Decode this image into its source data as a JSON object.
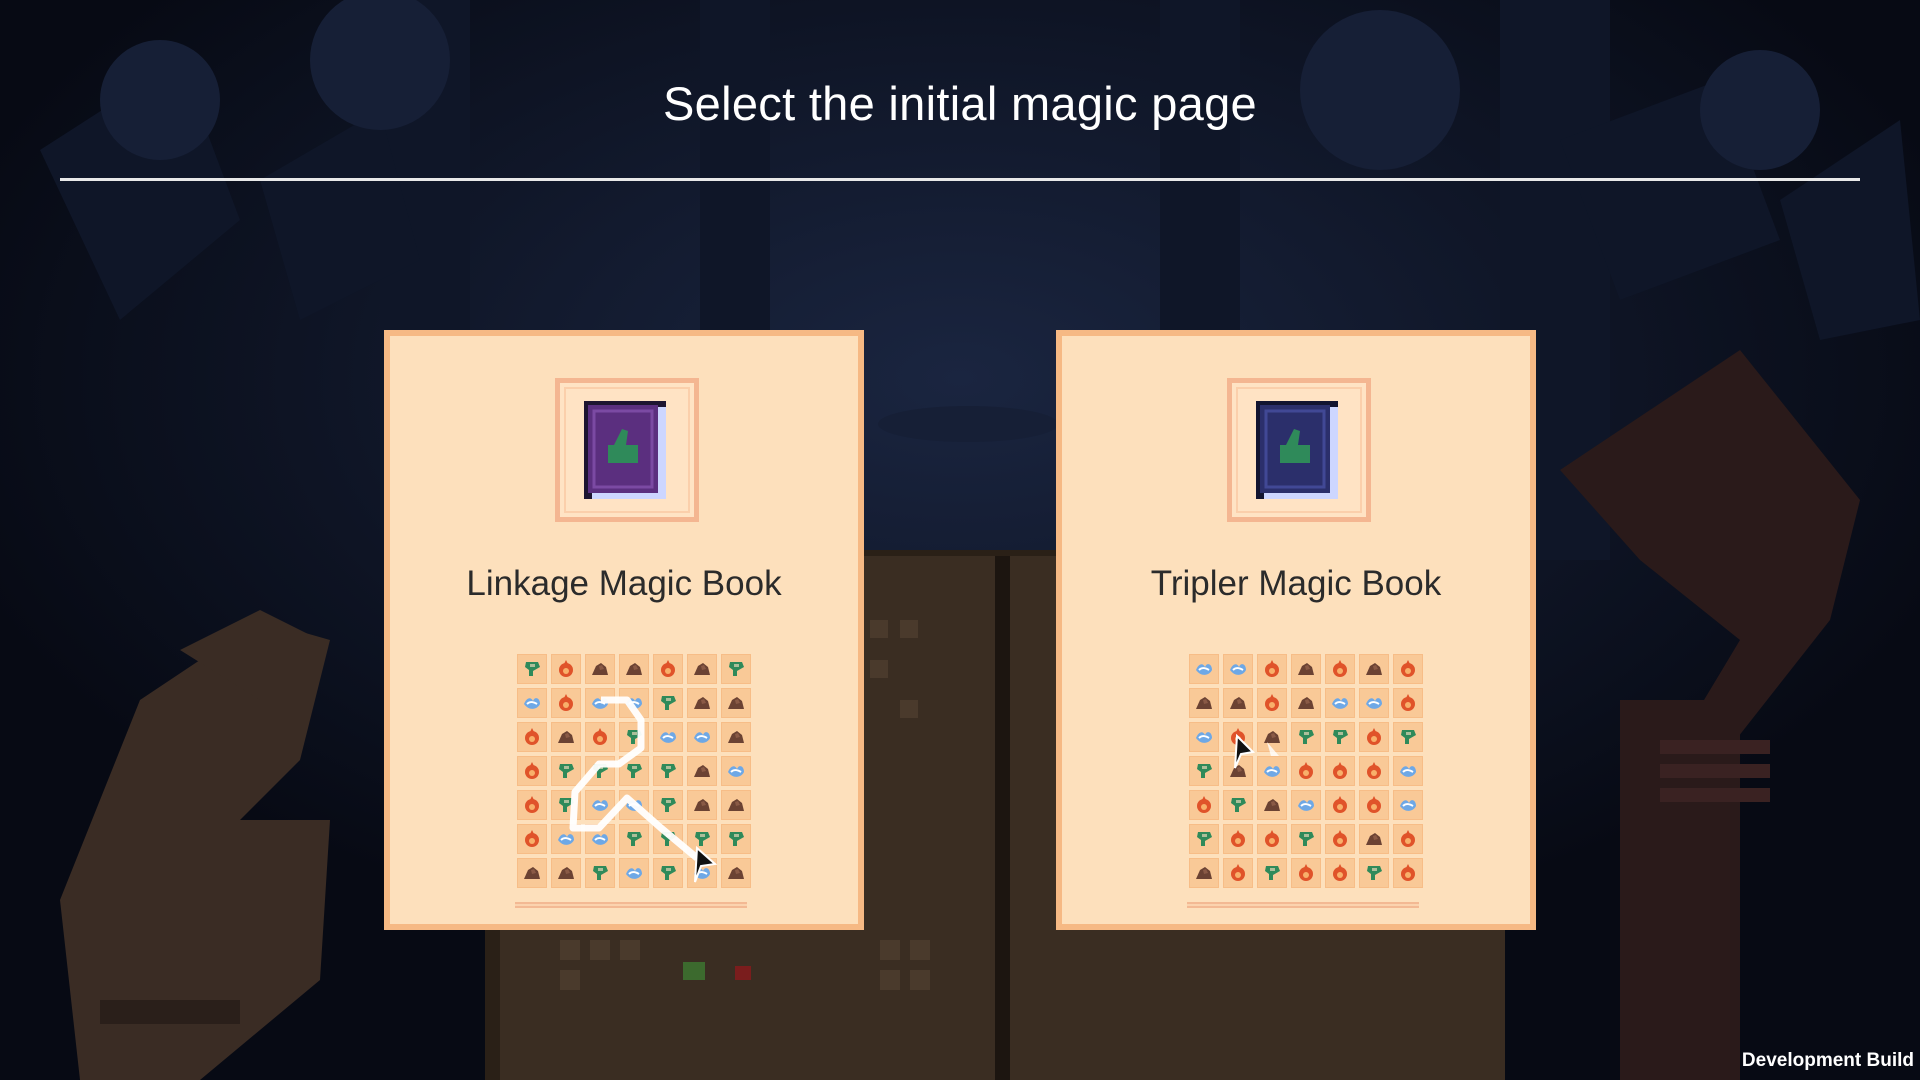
{
  "screen": {
    "title": "Select the initial magic page",
    "build_label": "Development Build"
  },
  "choices": [
    {
      "name": "Linkage Magic Book",
      "book_color": "#5b2f7f",
      "grid": [
        [
          "leaf",
          "fire",
          "rock",
          "rock",
          "fire",
          "rock",
          "leaf"
        ],
        [
          "water",
          "fire",
          "water",
          "water",
          "leaf",
          "rock",
          "rock"
        ],
        [
          "fire",
          "rock",
          "fire",
          "leaf",
          "water",
          "water",
          "rock"
        ],
        [
          "fire",
          "leaf",
          "leaf",
          "leaf",
          "leaf",
          "rock",
          "water"
        ],
        [
          "fire",
          "leaf",
          "water",
          "water",
          "leaf",
          "rock",
          "rock"
        ],
        [
          "fire",
          "water",
          "water",
          "leaf",
          "leaf",
          "leaf",
          "leaf"
        ],
        [
          "rock",
          "rock",
          "leaf",
          "water",
          "leaf",
          "water",
          "rock"
        ]
      ]
    },
    {
      "name": "Tripler Magic Book",
      "book_color": "#2b2f6b",
      "grid": [
        [
          "water",
          "water",
          "fire",
          "rock",
          "fire",
          "rock",
          "fire"
        ],
        [
          "rock",
          "rock",
          "fire",
          "rock",
          "water",
          "water",
          "fire"
        ],
        [
          "water",
          "fire",
          "rock",
          "leaf",
          "leaf",
          "fire",
          "leaf"
        ],
        [
          "leaf",
          "rock",
          "water",
          "fire",
          "fire",
          "fire",
          "water"
        ],
        [
          "fire",
          "leaf",
          "rock",
          "water",
          "fire",
          "fire",
          "water"
        ],
        [
          "leaf",
          "fire",
          "fire",
          "leaf",
          "fire",
          "rock",
          "fire"
        ],
        [
          "rock",
          "fire",
          "leaf",
          "fire",
          "fire",
          "leaf",
          "fire"
        ]
      ]
    }
  ],
  "rune_colors": {
    "leaf": "#2f8a5a",
    "fire": "#e0532a",
    "rock": "#6b4233",
    "water": "#6ea8e6"
  }
}
